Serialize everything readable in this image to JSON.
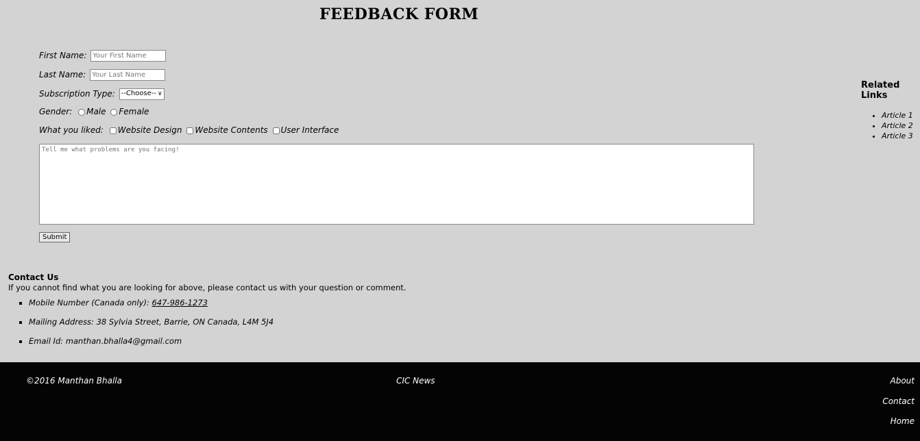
{
  "page_title": "FEEDBACK FORM",
  "form": {
    "first_name_label": "First Name:",
    "first_name_placeholder": "Your First Name",
    "last_name_label": "Last Name:",
    "last_name_placeholder": "Your Last Name",
    "subscription_label": "Subscription Type:",
    "subscription_selected": "--Choose--",
    "gender_label": "Gender:",
    "gender_options": [
      "Male",
      "Female"
    ],
    "liked_label": "What you liked:",
    "liked_options": [
      "Website Design",
      "Website Contents",
      "User Interface"
    ],
    "problems_placeholder": "Tell me what problems are you facing!",
    "submit_label": "Submit"
  },
  "related_links": {
    "title": "Related Links",
    "items": [
      "Article 1",
      "Article 2",
      "Article 3"
    ]
  },
  "contact": {
    "title": "Contact Us",
    "intro": "If you cannot find what you are looking for above, please contact us with your question or comment.",
    "phone_label": "Mobile Number (Canada only):",
    "phone_value": "647-986-1273",
    "address": "Mailing Address: 38 Sylvia Street, Barrie, ON Canada, L4M 5J4",
    "email": "Email Id: manthan.bhalla4@gmail.com"
  },
  "footer": {
    "copyright": "©2016 Manthan Bhalla",
    "news": "CIC News",
    "nav": [
      "About",
      "Contact",
      "Home"
    ]
  }
}
